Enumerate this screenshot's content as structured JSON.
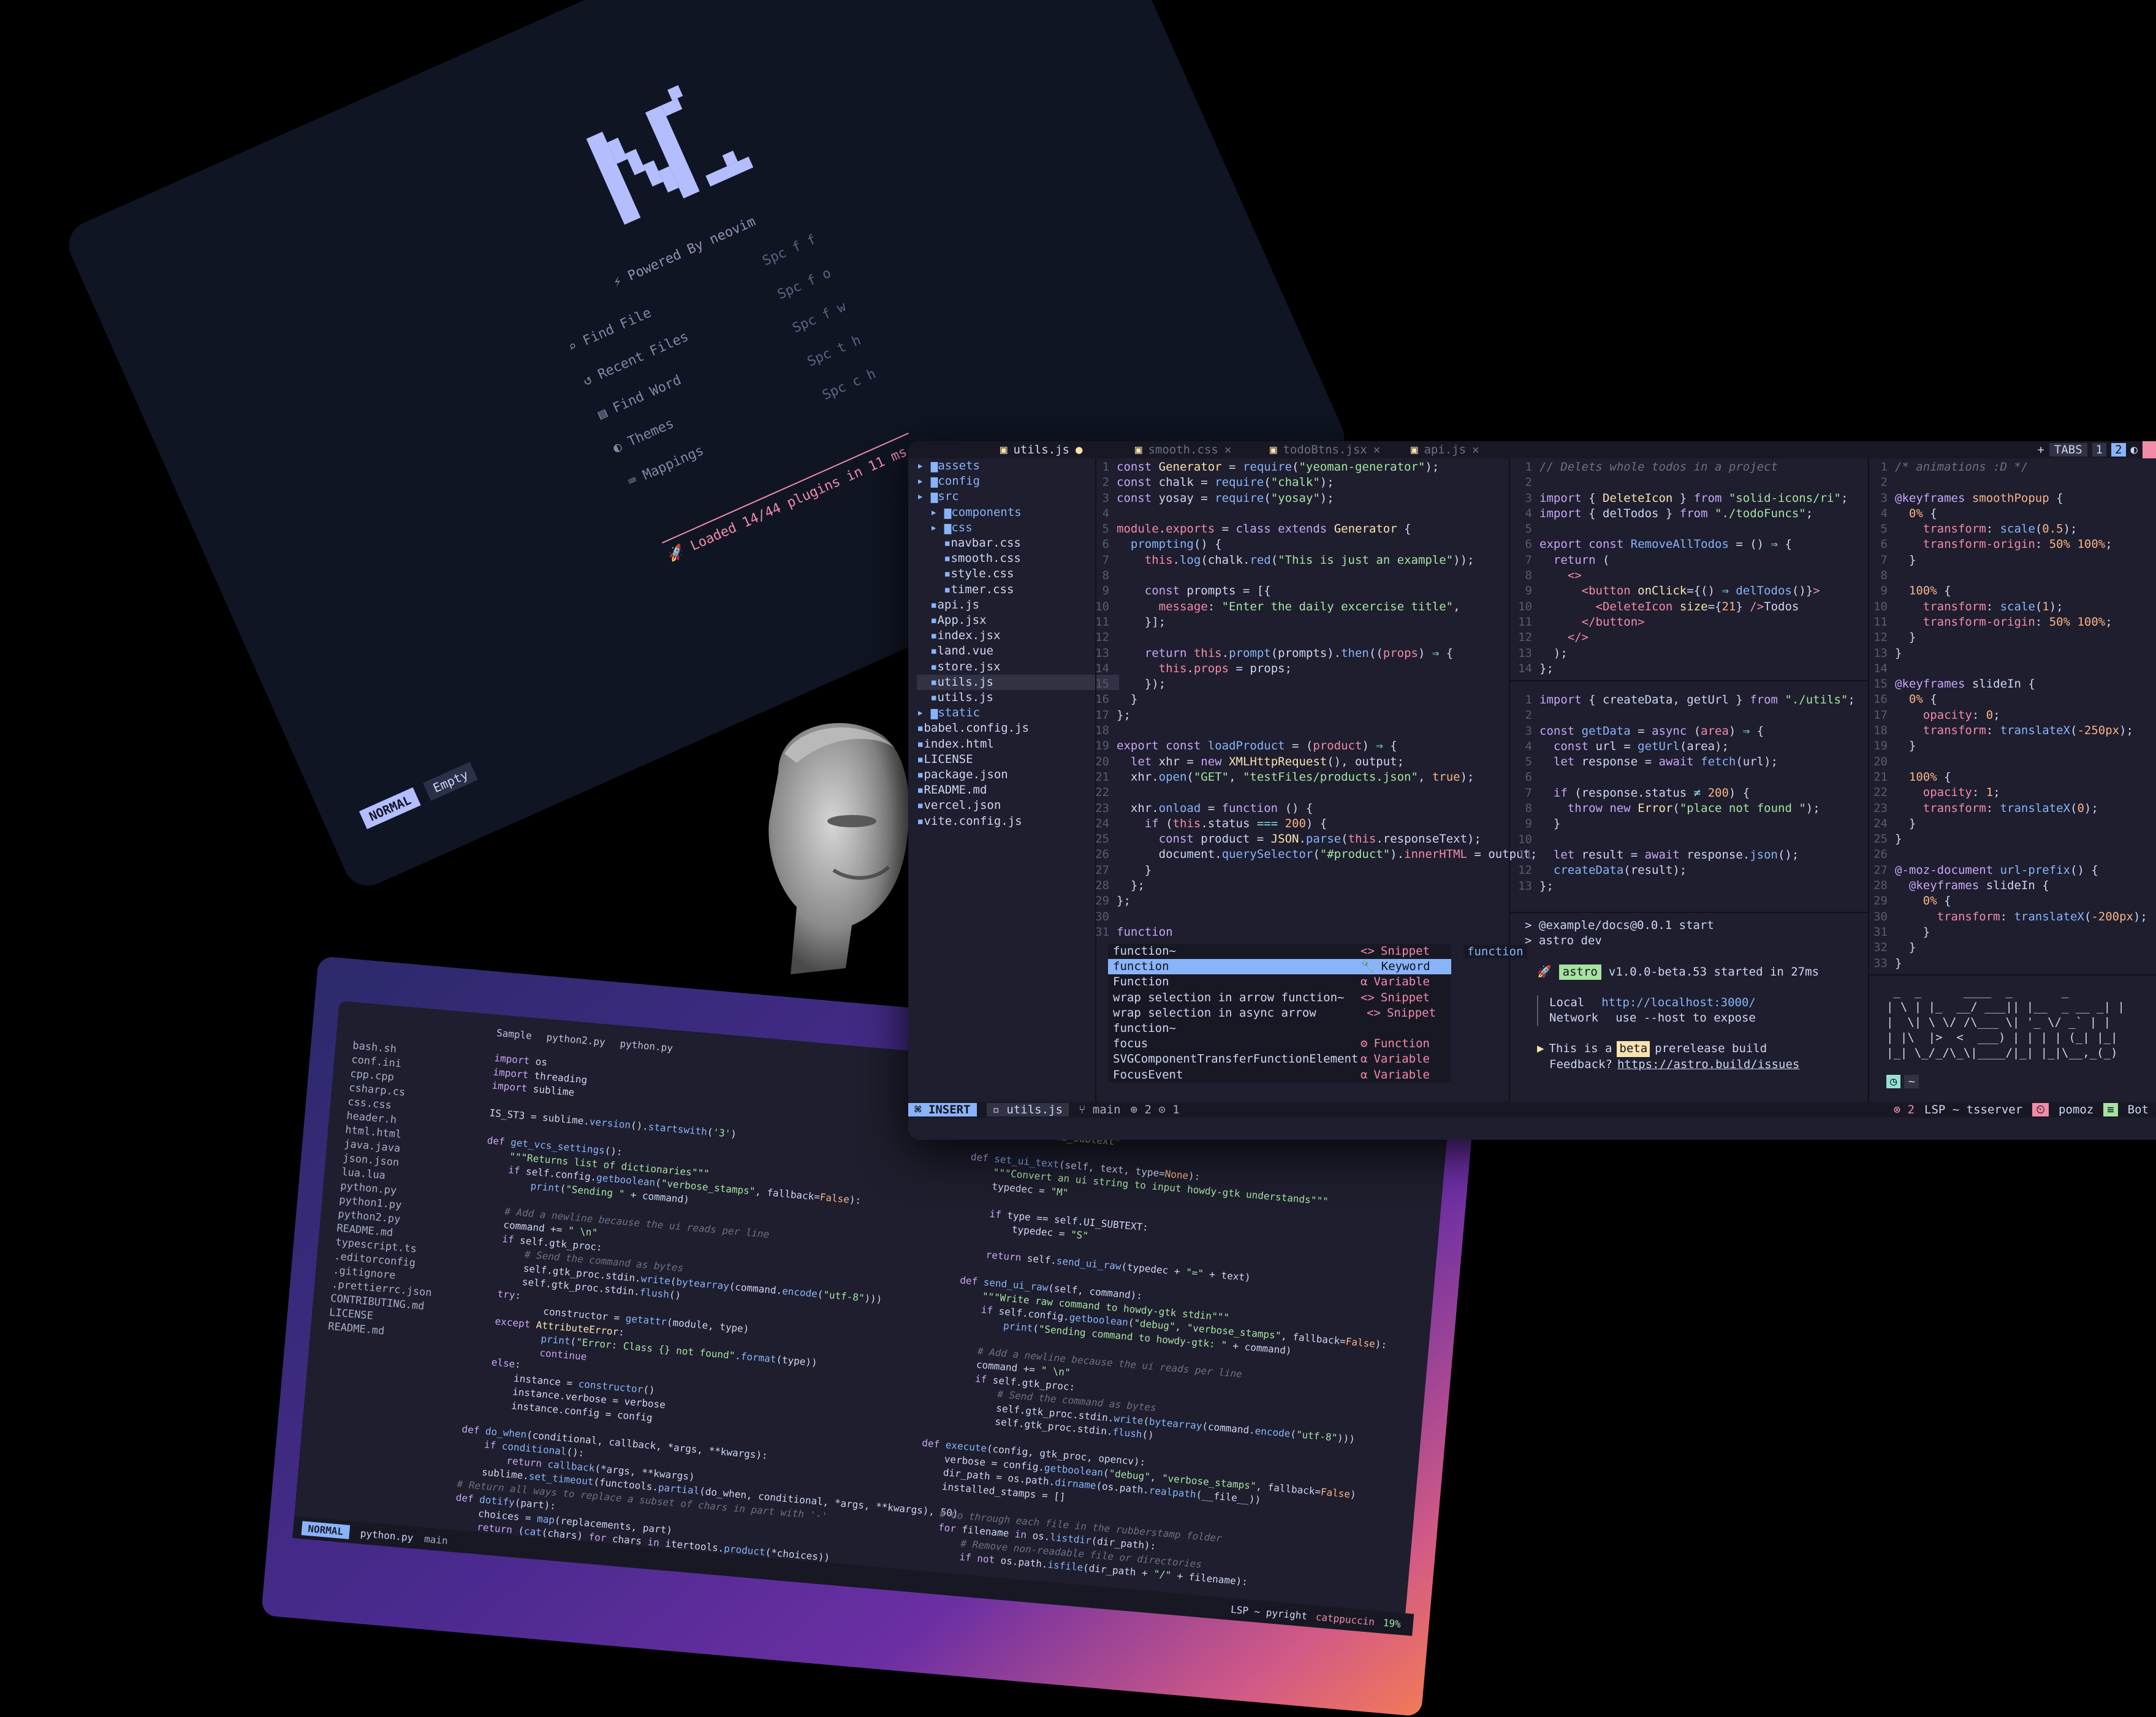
{
  "dashboard": {
    "powered_by": "Powered By",
    "neovim": "neovim",
    "items": [
      {
        "label": "Find File",
        "key": "Spc f f"
      },
      {
        "label": "Recent Files",
        "key": "Spc f o"
      },
      {
        "label": "Find Word",
        "key": "Spc f w"
      },
      {
        "label": "Themes",
        "key": "Spc t h"
      },
      {
        "label": "Mappings",
        "key": "Spc c h"
      }
    ],
    "loaded": "Loaded 14/44 plugins in 11 ms",
    "mode": "NORMAL",
    "buffer": "Empty"
  },
  "python_window": {
    "tabs": [
      "Sample",
      "python2.py",
      "python.py"
    ],
    "tree": [
      "bash.sh",
      "conf.ini",
      "cpp.cpp",
      "csharp.cs",
      "css.css",
      "header.h",
      "html.html",
      "java.java",
      "json.json",
      "lua.lua",
      "python.py",
      "python1.py",
      "python2.py",
      "README.md",
      "typescript.ts",
      ".editorconfig",
      ".gitignore",
      ".prettierrc.json",
      "CONTRIBUTING.md",
      "LICENSE",
      "README.md"
    ],
    "mode": "NORMAL",
    "file": "python.py",
    "branch": "main",
    "right_status": [
      "LSP ~ pyright",
      "catppuccin",
      "19%"
    ]
  },
  "main": {
    "tabs": [
      {
        "label": "utils.js",
        "active": true
      },
      {
        "label": "smooth.css",
        "active": false
      },
      {
        "label": "todoBtns.jsx",
        "active": false
      },
      {
        "label": "api.js",
        "active": false
      }
    ],
    "tabs_label": "TABS",
    "tab_nums": [
      "1",
      "2"
    ],
    "tree": [
      {
        "name": "assets",
        "dir": true,
        "lvl": 0
      },
      {
        "name": "config",
        "dir": true,
        "lvl": 0
      },
      {
        "name": "src",
        "dir": true,
        "lvl": 0
      },
      {
        "name": "components",
        "dir": true,
        "lvl": 1
      },
      {
        "name": "css",
        "dir": true,
        "lvl": 1
      },
      {
        "name": "navbar.css",
        "dir": false,
        "lvl": 2
      },
      {
        "name": "smooth.css",
        "dir": false,
        "lvl": 2
      },
      {
        "name": "style.css",
        "dir": false,
        "lvl": 2
      },
      {
        "name": "timer.css",
        "dir": false,
        "lvl": 2
      },
      {
        "name": "api.js",
        "dir": false,
        "lvl": 1
      },
      {
        "name": "App.jsx",
        "dir": false,
        "lvl": 1
      },
      {
        "name": "index.jsx",
        "dir": false,
        "lvl": 1
      },
      {
        "name": "land.vue",
        "dir": false,
        "lvl": 1
      },
      {
        "name": "store.jsx",
        "dir": false,
        "lvl": 1
      },
      {
        "name": "utils.js",
        "dir": false,
        "lvl": 1
      },
      {
        "name": "utils.js",
        "dir": false,
        "lvl": 1
      },
      {
        "name": "static",
        "dir": true,
        "lvl": 0
      },
      {
        "name": "babel.config.js",
        "dir": false,
        "lvl": 0
      },
      {
        "name": "index.html",
        "dir": false,
        "lvl": 0
      },
      {
        "name": "LICENSE",
        "dir": false,
        "lvl": 0
      },
      {
        "name": "package.json",
        "dir": false,
        "lvl": 0
      },
      {
        "name": "README.md",
        "dir": false,
        "lvl": 0
      },
      {
        "name": "vercel.json",
        "dir": false,
        "lvl": 0
      },
      {
        "name": "vite.config.js",
        "dir": false,
        "lvl": 0
      }
    ],
    "completion": [
      {
        "label": "function~",
        "kind": "Snippet",
        "icon": "<>"
      },
      {
        "label": "function",
        "kind": "Keyword",
        "icon": "🔧"
      },
      {
        "label": "Function",
        "kind": "Variable",
        "icon": "α"
      },
      {
        "label": "wrap selection in arrow function~",
        "kind": "Snippet",
        "icon": "<>"
      },
      {
        "label": "wrap selection in async arrow function~",
        "kind": "Snippet",
        "icon": "<>"
      },
      {
        "label": "focus",
        "kind": "Function",
        "icon": "⚙"
      },
      {
        "label": "SVGComponentTransferFunctionElement",
        "kind": "Variable",
        "icon": "α"
      },
      {
        "label": "FocusEvent",
        "kind": "Variable",
        "icon": "α"
      }
    ],
    "completion_doc": "function",
    "terminal": {
      "cmd1": "> @example/docs@0.0.1 start",
      "cmd2": "> astro dev",
      "astro_badge": "astro",
      "astro_msg": "v1.0.0-beta.53 started in 27ms",
      "local_label": "Local",
      "local_url": "http://localhost:3000/",
      "network_label": "Network",
      "network_val": "use --host to expose",
      "beta_pre": "This is a",
      "beta_badge": "beta",
      "beta_post": "prerelease build",
      "feedback": "Feedback?",
      "feedback_url": "https://astro.build/issues"
    },
    "status": {
      "mode": "INSERT",
      "file": "utils.js",
      "branch": "main",
      "added": "2",
      "changed": "1",
      "errors": "2",
      "lsp": "LSP ~ tsserver",
      "pomo": "pomoz",
      "pos": "Bot"
    }
  }
}
